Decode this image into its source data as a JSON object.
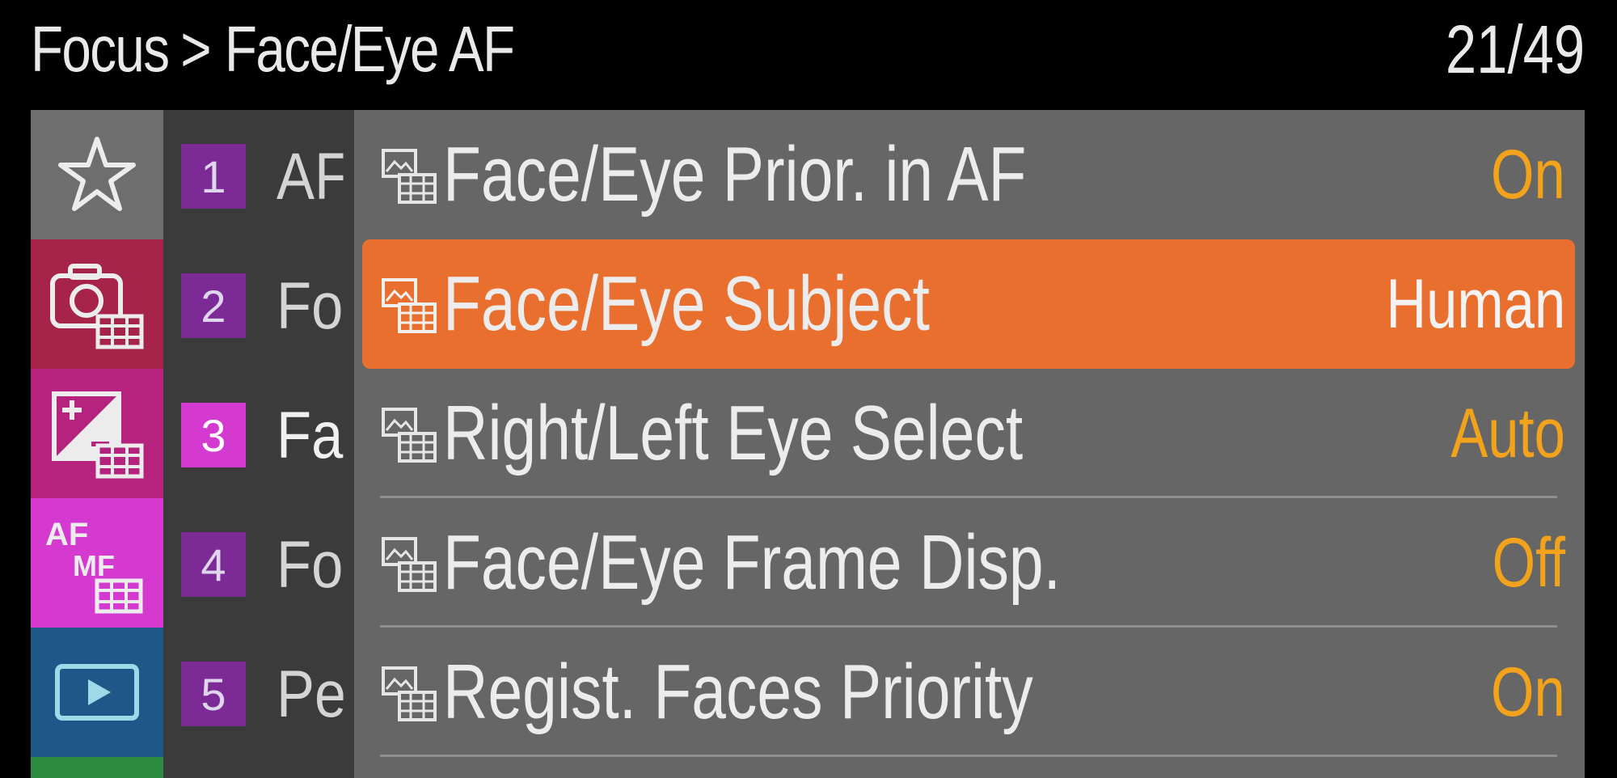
{
  "header": {
    "breadcrumb_parent": "Focus",
    "breadcrumb_separator": ">",
    "breadcrumb_current": "Face/Eye AF",
    "page_counter": "21/49"
  },
  "categories": [
    {
      "name": "my-menu",
      "icon": "star-icon",
      "color": "#6e6e6e",
      "icon_text": ""
    },
    {
      "name": "shooting",
      "icon": "camera-movie-icon",
      "color": "#a6244a",
      "icon_text": ""
    },
    {
      "name": "exposure-color",
      "icon": "exposure-comp-movie-icon",
      "color": "#b5237f",
      "icon_text": ""
    },
    {
      "name": "focus",
      "icon": "af-mf-movie-icon",
      "color": "#d43ad0",
      "icon_text": "AF",
      "icon_text2": "MF"
    },
    {
      "name": "playback",
      "icon": "playback-icon",
      "color": "#1f5888",
      "icon_text": ""
    }
  ],
  "subcategories": [
    {
      "num": "1",
      "label": "AF",
      "color": "#7b2a96"
    },
    {
      "num": "2",
      "label": "Fo",
      "color": "#7b2a96"
    },
    {
      "num": "3",
      "label": "Fa",
      "color": "#d43ad0"
    },
    {
      "num": "4",
      "label": "Fo",
      "color": "#7b2a96"
    },
    {
      "num": "5",
      "label": "Pe",
      "color": "#7b2a96"
    }
  ],
  "menu_items": [
    {
      "label": "Face/Eye Prior. in AF",
      "value": "On",
      "value_color": "#f2a31b"
    },
    {
      "label": "Face/Eye Subject",
      "value": "Human",
      "value_color": "#f3f3f3",
      "selected": true
    },
    {
      "label": "Right/Left Eye Select",
      "value": "Auto",
      "value_color": "#f2a31b"
    },
    {
      "label": "Face/Eye Frame Disp.",
      "value": "Off",
      "value_color": "#f2a31b"
    },
    {
      "label": "Regist. Faces Priority",
      "value": "On",
      "value_color": "#f2a31b"
    }
  ],
  "colors": {
    "selected_row": "#e96f2e",
    "value_accent": "#f2a31b",
    "panel_bg": "#666666"
  }
}
